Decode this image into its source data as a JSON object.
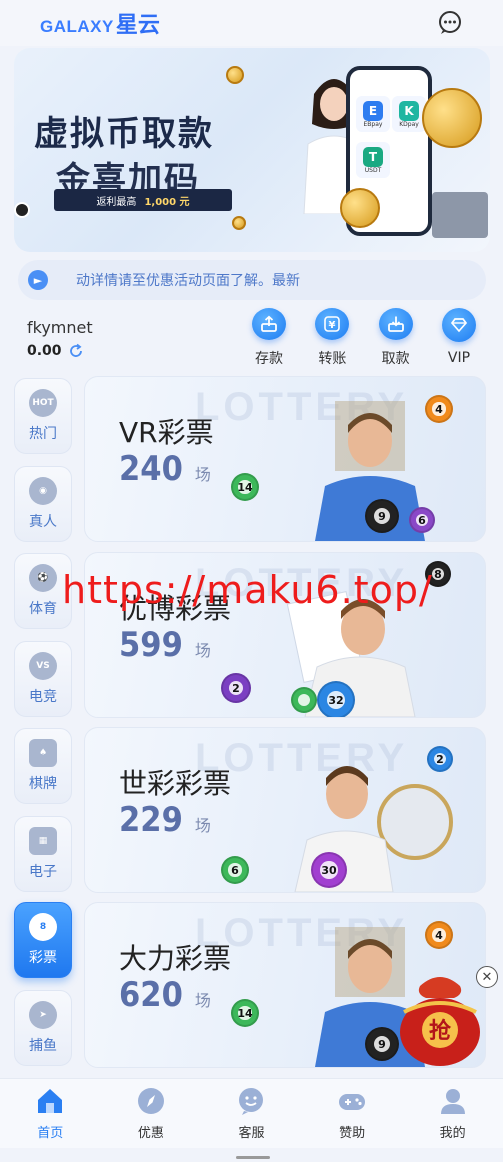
{
  "header": {
    "logo_en": "GALAXY",
    "logo_cn": "星云",
    "chat_icon": "chat-bubble-icon"
  },
  "banner": {
    "title_line1": "虚拟币取款",
    "title_line2": "金喜加码",
    "sub_label": "返利最高",
    "sub_amount": "1,000 元",
    "pay_tiles": [
      "EBpay",
      "KDpay",
      "USDT"
    ]
  },
  "marquee": {
    "icon": "speaker-icon",
    "text": "动详情请至优惠活动页面了解。最新"
  },
  "user": {
    "name": "fkymnet",
    "balance": "0.00"
  },
  "quick_actions": [
    {
      "label": "存款",
      "icon": "deposit-icon"
    },
    {
      "label": "转账",
      "icon": "transfer-icon"
    },
    {
      "label": "取款",
      "icon": "withdraw-icon"
    },
    {
      "label": "VIP",
      "icon": "vip-diamond-icon"
    }
  ],
  "side_nav": [
    {
      "label": "热门",
      "icon": "hot-icon",
      "badge": "HOT"
    },
    {
      "label": "真人",
      "icon": "live-casino-icon",
      "badge": ""
    },
    {
      "label": "体育",
      "icon": "soccer-ball-icon",
      "badge": ""
    },
    {
      "label": "电竞",
      "icon": "esports-icon",
      "badge": "VS"
    },
    {
      "label": "棋牌",
      "icon": "cards-icon",
      "badge": ""
    },
    {
      "label": "电子",
      "icon": "slot-machine-icon",
      "badge": ""
    },
    {
      "label": "彩票",
      "icon": "lottery-ball-icon",
      "badge": "8"
    },
    {
      "label": "捕鱼",
      "icon": "fish-icon",
      "badge": ""
    }
  ],
  "cards": [
    {
      "title": "VR彩票",
      "count": "240",
      "unit": "场",
      "watermark": "LOTTERY"
    },
    {
      "title": "优博彩票",
      "count": "599",
      "unit": "场",
      "watermark": "LOTTERY"
    },
    {
      "title": "世彩彩票",
      "count": "229",
      "unit": "场",
      "watermark": "LOTTERY"
    },
    {
      "title": "大力彩票",
      "count": "620",
      "unit": "场",
      "watermark": "LOTTERY"
    }
  ],
  "overlay_url": "https://maku6.top/",
  "red_packet": {
    "char": "抢"
  },
  "tabbar": [
    {
      "label": "首页",
      "icon": "home-icon",
      "active": true
    },
    {
      "label": "优惠",
      "icon": "compass-icon",
      "active": false
    },
    {
      "label": "客服",
      "icon": "support-icon",
      "active": false
    },
    {
      "label": "赞助",
      "icon": "gamepad-icon",
      "active": false
    },
    {
      "label": "我的",
      "icon": "user-icon",
      "active": false
    }
  ],
  "colors": {
    "brand": "#2f6ef5",
    "accent_blue": "#1f78ef",
    "overlay_red": "#ee1c1c",
    "count_color": "#5a6fa8"
  }
}
